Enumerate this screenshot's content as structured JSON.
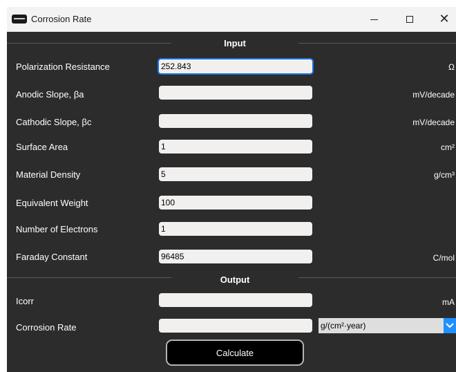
{
  "window": {
    "title": "Corrosion Rate"
  },
  "input_section": {
    "title": "Input",
    "rows": [
      {
        "label": "Polarization Resistance",
        "value": "252.843",
        "unit": "Ω"
      },
      {
        "label": "Anodic Slope, βa",
        "value": "",
        "unit": "mV/decade"
      },
      {
        "label": "Cathodic Slope, βc",
        "value": "",
        "unit": "mV/decade"
      },
      {
        "label": "Surface Area",
        "value": "1",
        "unit": "cm²"
      },
      {
        "label": "Material Density",
        "value": "5",
        "unit": "g/cm³"
      },
      {
        "label": "Equivalent Weight",
        "value": "100",
        "unit": ""
      },
      {
        "label": "Number of Electrons",
        "value": "1",
        "unit": ""
      },
      {
        "label": "Faraday Constant",
        "value": "96485",
        "unit": "C/mol"
      }
    ]
  },
  "output_section": {
    "title": "Output",
    "icorr": {
      "label": "Icorr",
      "value": "",
      "unit": "mA"
    },
    "corrosion_rate": {
      "label": "Corrosion Rate",
      "value": "",
      "unit_selected": "g/(cm²·year)"
    }
  },
  "actions": {
    "calculate_label": "Calculate"
  },
  "colors": {
    "background": "#2c2c2c",
    "titlebar": "#f3f3f3",
    "focus_ring": "#1a73e8",
    "dropdown_accent": "#1e90ff",
    "button": "#000000"
  },
  "icons": [
    "app-icon",
    "minimize-icon",
    "maximize-icon",
    "close-icon",
    "chevron-down-icon"
  ]
}
